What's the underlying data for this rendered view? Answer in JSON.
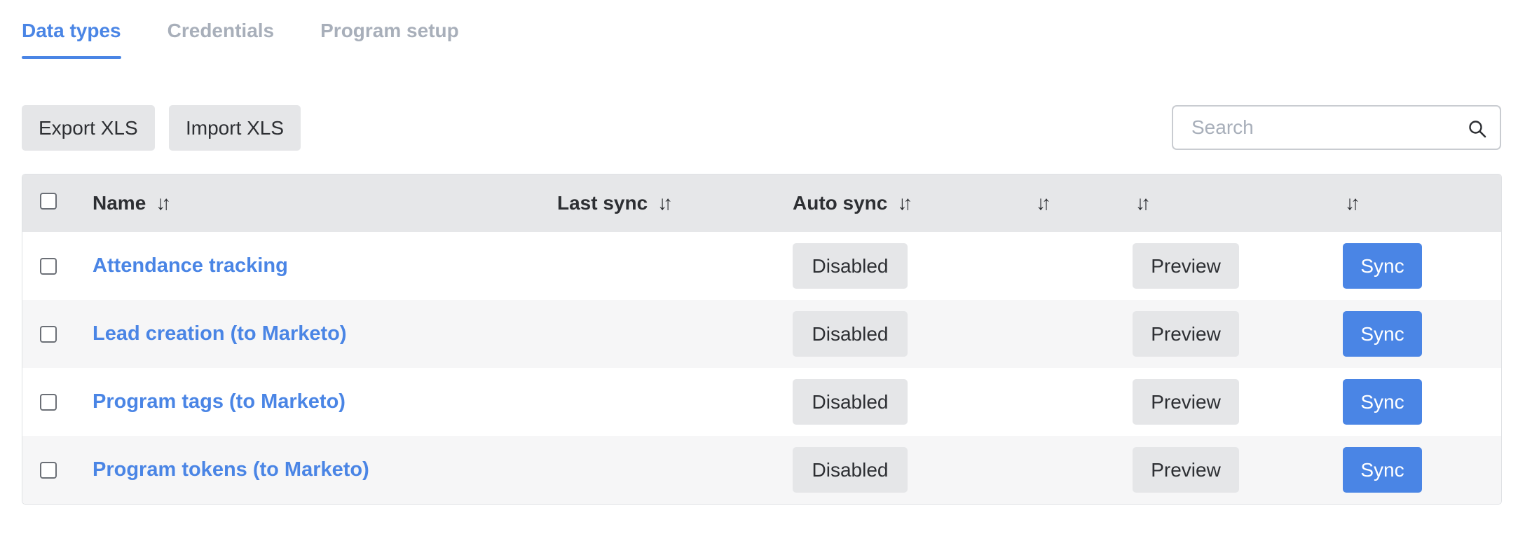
{
  "tabs": [
    {
      "label": "Data types",
      "active": true
    },
    {
      "label": "Credentials",
      "active": false
    },
    {
      "label": "Program setup",
      "active": false
    }
  ],
  "toolbar": {
    "export_label": "Export XLS",
    "import_label": "Import XLS",
    "search_placeholder": "Search",
    "search_value": ""
  },
  "table": {
    "columns": [
      {
        "label": "Name",
        "sortable": true
      },
      {
        "label": "Last sync",
        "sortable": true
      },
      {
        "label": "Auto sync",
        "sortable": true
      },
      {
        "label": "",
        "sortable": true
      },
      {
        "label": "",
        "sortable": true
      },
      {
        "label": "",
        "sortable": true
      }
    ],
    "sort_icon": "↓↑",
    "rows": [
      {
        "name": "Attendance tracking",
        "last_sync": "",
        "auto_sync": "Disabled",
        "preview": "Preview",
        "sync": "Sync"
      },
      {
        "name": "Lead creation (to Marketo)",
        "last_sync": "",
        "auto_sync": "Disabled",
        "preview": "Preview",
        "sync": "Sync"
      },
      {
        "name": "Program tags (to Marketo)",
        "last_sync": "",
        "auto_sync": "Disabled",
        "preview": "Preview",
        "sync": "Sync"
      },
      {
        "name": "Program tokens (to Marketo)",
        "last_sync": "",
        "auto_sync": "Disabled",
        "preview": "Preview",
        "sync": "Sync"
      }
    ]
  },
  "colors": {
    "accent": "#4a85e5",
    "inactive_tab": "#a8afba",
    "button_gray": "#e5e6e8",
    "header_bg": "#e6e7e9",
    "text": "#2d2f33"
  },
  "icons": {
    "search": "search-icon",
    "sort": "sort-icon",
    "checkbox": "checkbox-icon"
  }
}
